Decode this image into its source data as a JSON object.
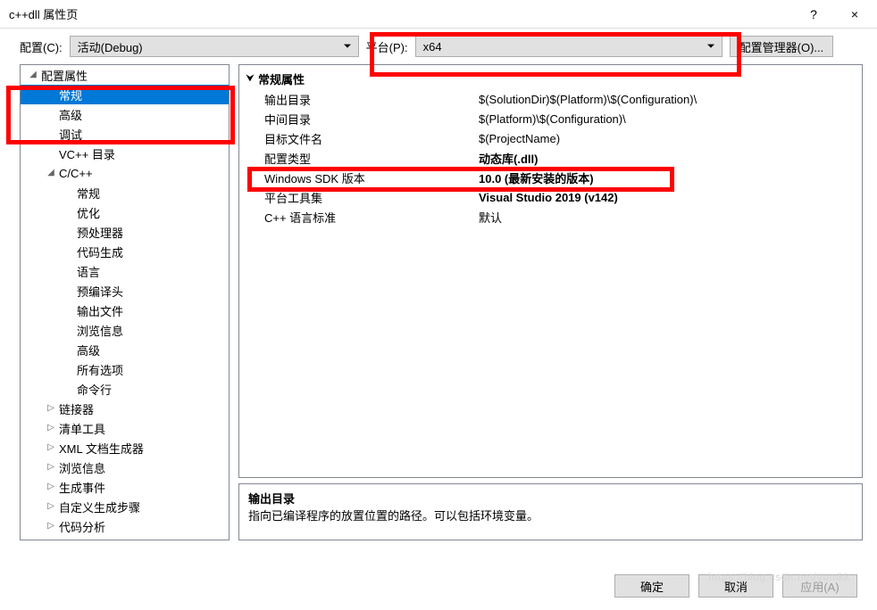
{
  "window": {
    "title": "c++dll 属性页",
    "help": "?",
    "close": "×"
  },
  "toolbar": {
    "config_label": "配置(C):",
    "config_value": "活动(Debug)",
    "platform_label": "平台(P):",
    "platform_value": "x64",
    "config_manager": "配置管理器(O)..."
  },
  "tree": {
    "root": "配置属性",
    "items": [
      {
        "label": "常规",
        "lvl": 1,
        "expander": "",
        "selected": true
      },
      {
        "label": "高级",
        "lvl": 1,
        "expander": ""
      },
      {
        "label": "调试",
        "lvl": 1,
        "expander": ""
      },
      {
        "label": "VC++ 目录",
        "lvl": 1,
        "expander": ""
      },
      {
        "label": "C/C++",
        "lvl": 1,
        "expander": "◢"
      },
      {
        "label": "常规",
        "lvl": 2,
        "expander": ""
      },
      {
        "label": "优化",
        "lvl": 2,
        "expander": ""
      },
      {
        "label": "预处理器",
        "lvl": 2,
        "expander": ""
      },
      {
        "label": "代码生成",
        "lvl": 2,
        "expander": ""
      },
      {
        "label": "语言",
        "lvl": 2,
        "expander": ""
      },
      {
        "label": "预编译头",
        "lvl": 2,
        "expander": ""
      },
      {
        "label": "输出文件",
        "lvl": 2,
        "expander": ""
      },
      {
        "label": "浏览信息",
        "lvl": 2,
        "expander": ""
      },
      {
        "label": "高级",
        "lvl": 2,
        "expander": ""
      },
      {
        "label": "所有选项",
        "lvl": 2,
        "expander": ""
      },
      {
        "label": "命令行",
        "lvl": 2,
        "expander": ""
      },
      {
        "label": "链接器",
        "lvl": 1,
        "expander": "▷"
      },
      {
        "label": "清单工具",
        "lvl": 1,
        "expander": "▷"
      },
      {
        "label": "XML 文档生成器",
        "lvl": 1,
        "expander": "▷"
      },
      {
        "label": "浏览信息",
        "lvl": 1,
        "expander": "▷"
      },
      {
        "label": "生成事件",
        "lvl": 1,
        "expander": "▷"
      },
      {
        "label": "自定义生成步骤",
        "lvl": 1,
        "expander": "▷"
      },
      {
        "label": "代码分析",
        "lvl": 1,
        "expander": "▷"
      }
    ]
  },
  "properties": {
    "group": "常规属性",
    "rows": [
      {
        "key": "输出目录",
        "val": "$(SolutionDir)$(Platform)\\$(Configuration)\\",
        "bold": false
      },
      {
        "key": "中间目录",
        "val": "$(Platform)\\$(Configuration)\\",
        "bold": false
      },
      {
        "key": "目标文件名",
        "val": "$(ProjectName)",
        "bold": false
      },
      {
        "key": "配置类型",
        "val": "动态库(.dll)",
        "bold": true
      },
      {
        "key": "Windows SDK 版本",
        "val": "10.0 (最新安装的版本)",
        "bold": true
      },
      {
        "key": "平台工具集",
        "val": "Visual Studio 2019 (v142)",
        "bold": true
      },
      {
        "key": "C++ 语言标准",
        "val": "默认",
        "bold": false
      }
    ]
  },
  "help": {
    "title": "输出目录",
    "desc": "指向已编译程序的放置位置的路径。可以包括环境变量。"
  },
  "buttons": {
    "ok": "确定",
    "cancel": "取消",
    "apply": "应用(A)"
  },
  "watermark": "https://blog.csdn.net/yumkk"
}
